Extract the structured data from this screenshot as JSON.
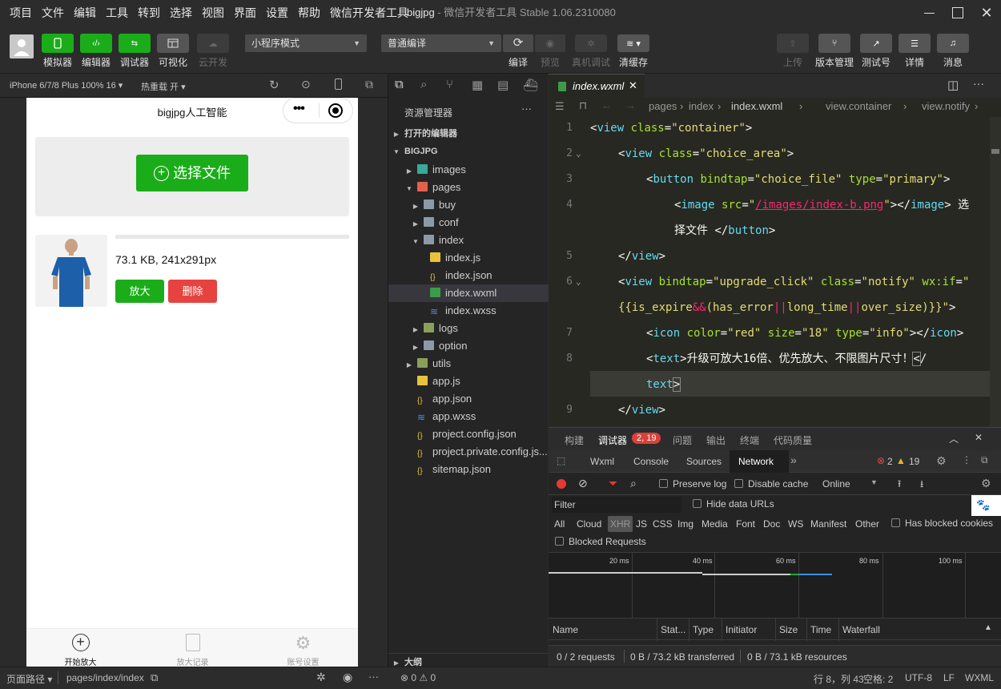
{
  "menubar": {
    "items": [
      "项目",
      "文件",
      "编辑",
      "工具",
      "转到",
      "选择",
      "视图",
      "界面",
      "设置",
      "帮助",
      "微信开发者工具"
    ]
  },
  "window": {
    "project": "bigjpg",
    "subtitle": "- 微信开发者工具 Stable 1.06.2310080"
  },
  "toolbar": {
    "simulator": "模拟器",
    "editor": "编辑器",
    "debugger": "调试器",
    "visual": "可视化",
    "cloud": "云开发",
    "mode": "小程序模式",
    "compile_mode": "普通编译",
    "compile": "编译",
    "preview": "预览",
    "real_debug": "真机调试",
    "clear_cache": "清缓存",
    "upload": "上传",
    "version": "版本管理",
    "test": "测试号",
    "details": "详情",
    "messages": "消息"
  },
  "simbar": {
    "device": "iPhone 6/7/8 Plus 100% 16",
    "hot_reload": "热重载 开"
  },
  "phone": {
    "nav_title": "bigjpg人工智能",
    "choose_btn": "选择文件",
    "file_info": "73.1 KB, 241x291px",
    "enlarge_btn": "放大",
    "delete_btn": "删除",
    "tabs": [
      "开始放大",
      "放大记录",
      "账号设置"
    ]
  },
  "explorer": {
    "title": "资源管理器",
    "open_editors": "打开的编辑器",
    "root": "BIGJPG",
    "items": [
      "images",
      "pages",
      "buy",
      "conf",
      "index",
      "index.js",
      "index.json",
      "index.wxml",
      "index.wxss",
      "logs",
      "option",
      "utils",
      "app.js",
      "app.json",
      "app.wxss",
      "project.config.json",
      "project.private.config.js...",
      "sitemap.json"
    ],
    "outline": "大纲"
  },
  "editor": {
    "tab": "index.wxml",
    "breadcrumb": [
      "pages",
      "index",
      "index.wxml",
      "view.container",
      "view.notify"
    ],
    "line_numbers": [
      "1",
      "2",
      "3",
      "4",
      "5",
      "6",
      "7",
      "8",
      "9"
    ]
  },
  "devtools": {
    "top_tabs": [
      "构建",
      "调试器",
      "问题",
      "输出",
      "终端",
      "代码质量"
    ],
    "badge": "2, 19",
    "panels": [
      "Wxml",
      "Console",
      "Sources",
      "Network"
    ],
    "errors": "2",
    "warnings": "19",
    "preserve_log": "Preserve log",
    "disable_cache": "Disable cache",
    "throttle": "Online",
    "filter_placeholder": "Filter",
    "hide_data_urls": "Hide data URLs",
    "types": [
      "All",
      "Cloud",
      "XHR",
      "JS",
      "CSS",
      "Img",
      "Media",
      "Font",
      "Doc",
      "WS",
      "Manifest",
      "Other"
    ],
    "has_blocked": "Has blocked cookies",
    "blocked_requests": "Blocked Requests",
    "timeline": [
      "20 ms",
      "40 ms",
      "60 ms",
      "80 ms",
      "100 ms"
    ],
    "columns": [
      "Name",
      "Stat...",
      "Type",
      "Initiator",
      "Size",
      "Time",
      "Waterfall"
    ],
    "summary": [
      "0 / 2 requests",
      "0 B / 73.2 kB transferred",
      "0 B / 73.1 kB resources"
    ]
  },
  "status": {
    "page_path_label": "页面路径",
    "page_path": "pages/index/index",
    "errors": "0",
    "warnings": "0",
    "cursor": "行 8，列 43",
    "indent": "空格: 2",
    "encoding": "UTF-8",
    "eol": "LF",
    "lang": "WXML"
  }
}
